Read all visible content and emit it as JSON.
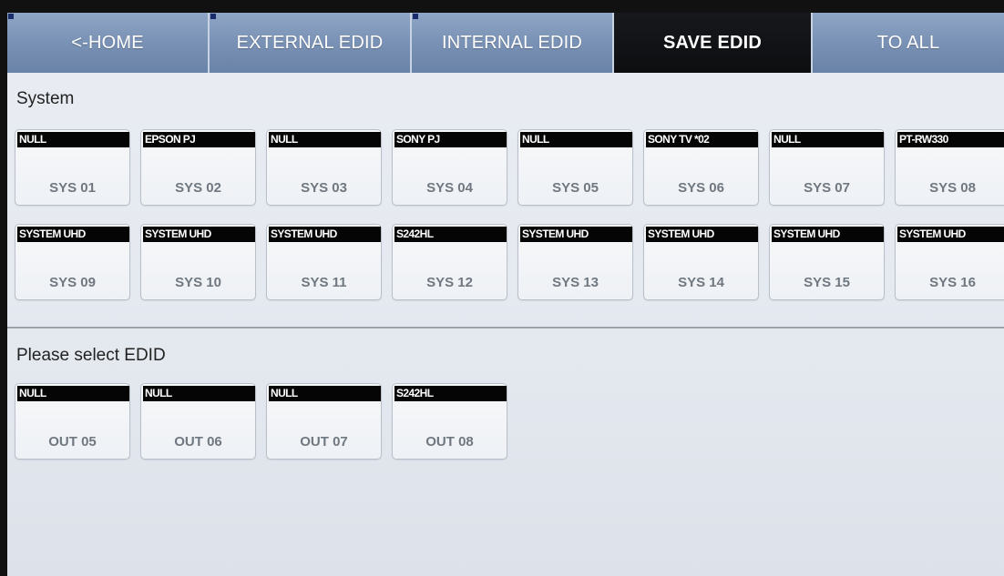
{
  "tabs": [
    {
      "label": "<-HOME",
      "active": false,
      "marker": true
    },
    {
      "label": "EXTERNAL EDID",
      "active": false,
      "marker": true
    },
    {
      "label": "INTERNAL EDID",
      "active": false,
      "marker": true
    },
    {
      "label": "SAVE EDID",
      "active": true,
      "marker": false
    },
    {
      "label": "TO ALL",
      "active": false,
      "marker": false
    }
  ],
  "system": {
    "title": "System",
    "slots": [
      {
        "name": "NULL",
        "id": "SYS 01"
      },
      {
        "name": "EPSON PJ",
        "id": "SYS 02"
      },
      {
        "name": "NULL",
        "id": "SYS 03"
      },
      {
        "name": "SONY PJ",
        "id": "SYS 04"
      },
      {
        "name": "NULL",
        "id": "SYS 05"
      },
      {
        "name": "SONY TV *02",
        "id": "SYS 06"
      },
      {
        "name": "NULL",
        "id": "SYS 07"
      },
      {
        "name": "PT-RW330",
        "id": "SYS 08"
      },
      {
        "name": "SYSTEM UHD",
        "id": "SYS 09"
      },
      {
        "name": "SYSTEM UHD",
        "id": "SYS 10"
      },
      {
        "name": "SYSTEM UHD",
        "id": "SYS 11"
      },
      {
        "name": "S242HL",
        "id": "SYS 12"
      },
      {
        "name": "SYSTEM UHD",
        "id": "SYS 13"
      },
      {
        "name": "SYSTEM UHD",
        "id": "SYS 14"
      },
      {
        "name": "SYSTEM UHD",
        "id": "SYS 15"
      },
      {
        "name": "SYSTEM UHD",
        "id": "SYS 16"
      }
    ]
  },
  "select": {
    "title": "Please select EDID",
    "slots": [
      {
        "name": "NULL",
        "id": "OUT 05"
      },
      {
        "name": "NULL",
        "id": "OUT 06"
      },
      {
        "name": "NULL",
        "id": "OUT 07"
      },
      {
        "name": "S242HL",
        "id": "OUT 08"
      }
    ]
  },
  "colors": {
    "tab": "#7b93b6",
    "tab_active": "#0d0e10",
    "label_bar": "#050505",
    "slot_id_text": "#6f7780"
  }
}
